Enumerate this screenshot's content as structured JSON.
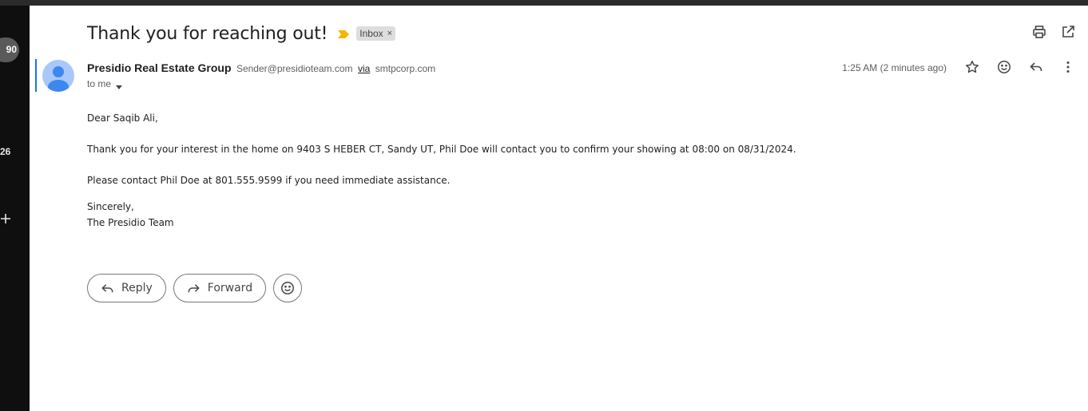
{
  "rail": {
    "badge": "90",
    "count": "26"
  },
  "email": {
    "subject": "Thank you for reaching out!",
    "label": "Inbox",
    "label_remove": "×",
    "sender_name": "Presidio Real Estate Group",
    "sender_email": "Sender@presidioteam.com",
    "via": "via",
    "via_domain": "smtpcorp.com",
    "to": "to me",
    "time": "1:25 AM (2 minutes ago)",
    "body": {
      "greeting": "Dear Saqib Ali,",
      "p1": "Thank you for your interest in the home on 9403 S HEBER CT, Sandy UT, Phil Doe will contact you to confirm your showing at 08:00 on 08/31/2024.",
      "p2": "Please contact Phil Doe at 801.555.9599 if you need immediate assistance.",
      "closing": "Sincerely,",
      "signature": "The Presidio Team"
    }
  },
  "actions": {
    "reply": "Reply",
    "forward": "Forward"
  },
  "colors": {
    "accent": "#1a73e8",
    "importance": "#f4b400"
  },
  "icons": [
    "print-icon",
    "open-in-new-window-icon",
    "star-icon",
    "emoji-icon",
    "reply-icon",
    "more-vert-icon",
    "forward-icon",
    "plus-icon",
    "importance-marker-icon",
    "avatar-icon"
  ]
}
